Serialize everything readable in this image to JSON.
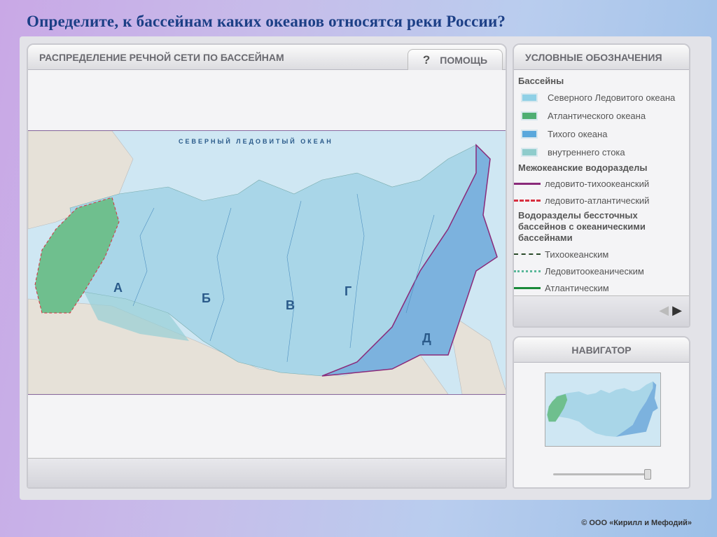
{
  "slide_title": "Определите, к бассейнам каких океанов относятся реки России?",
  "main_panel": {
    "title": "РАСПРЕДЕЛЕНИЕ РЕЧНОЙ СЕТИ ПО БАССЕЙНАМ",
    "help_icon": "?",
    "help_label": "ПОМОЩЬ"
  },
  "map": {
    "ocean_label": "СЕВЕРНЫЙ ЛЕДОВИТЫЙ ОКЕАН",
    "letters": [
      "А",
      "Б",
      "В",
      "Г",
      "Д"
    ],
    "colors": {
      "arctic": "#a9d6e8",
      "atlantic": "#6fbf8e",
      "pacific": "#7cb2de",
      "internal": "#95cfd6"
    }
  },
  "legend": {
    "title": "УСЛОВНЫЕ ОБОЗНАЧЕНИЯ",
    "basins_heading": "Бассейны",
    "basins": [
      {
        "label": "Северного Ледовитого океана",
        "color": "#8fd0e6"
      },
      {
        "label": "Атлантического океана",
        "color": "#4fae72"
      },
      {
        "label": "Тихого океана",
        "color": "#5aa8dc"
      },
      {
        "label": "внутреннего стока",
        "color": "#8fcccc"
      }
    ],
    "divides_heading": "Межокеанские водоразделы",
    "divides": [
      {
        "label": "ледовито-тихоокеанский",
        "color": "#8a2a7a"
      },
      {
        "label": "ледовито-атлантический",
        "color": "#d83040"
      }
    ],
    "closed_heading": "Водоразделы бессточных бассейнов с океаническими бассейнами",
    "closed": [
      {
        "label": "Тихоокеанским",
        "color": "#2a4a2a"
      },
      {
        "label": "Ледовитоокеаническим",
        "color": "#5ab89a"
      },
      {
        "label": "Атлантическим",
        "color": "#1a8a3a"
      }
    ],
    "prev_icon": "◀",
    "next_icon": "▶"
  },
  "navigator": {
    "title": "НАВИГАТОР",
    "zoom_fraction": 0.95
  },
  "footer": "© ООО «Кирилл и Мефодий»"
}
